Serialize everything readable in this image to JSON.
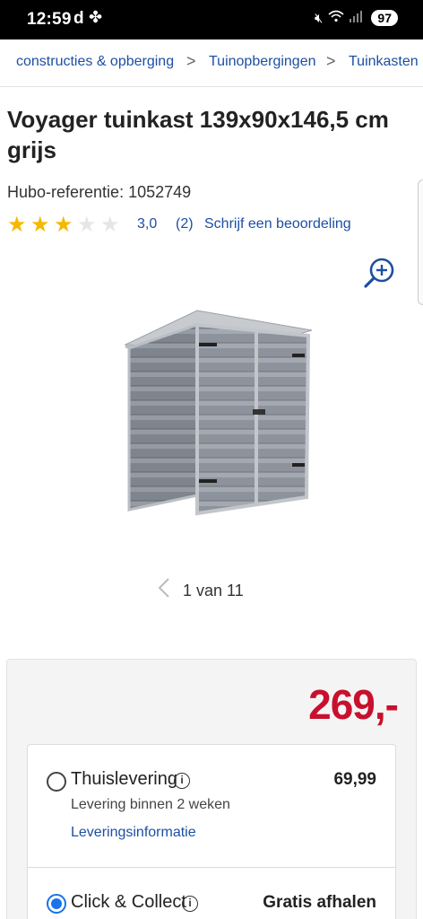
{
  "status_bar": {
    "time": "12:59",
    "carrier_glyph": "d",
    "battery": "97",
    "icons": [
      "pinwheel-icon",
      "mute-icon",
      "wifi-icon",
      "signal-icon",
      "battery-icon"
    ]
  },
  "breadcrumb": {
    "items": [
      "constructies & opberging",
      "Tuinopbergingen",
      "Tuinkasten"
    ],
    "separator": ">"
  },
  "product": {
    "title": "Voyager tuinkast 139x90x146,5 cm grijs",
    "reference": "Hubo-referentie: 1052749",
    "rating": {
      "value": "3,0",
      "count": "(2)",
      "stars": 3,
      "max": 5,
      "review_link": "Schrijf een beoordeling"
    }
  },
  "gallery": {
    "counter": "1 van 11",
    "icons": [
      "zoom-in-icon",
      "chevron-left-icon"
    ]
  },
  "pricing": {
    "price": "269,-",
    "options": [
      {
        "title": "Thuislevering",
        "price": "69,99",
        "subtitle": "Levering binnen 2 weken",
        "link": "Leveringsinformatie",
        "selected": false
      },
      {
        "title": "Click & Collect",
        "price": "Gratis afhalen",
        "selected": true
      }
    ]
  },
  "colors": {
    "link_blue": "#1d4fa3",
    "price_red": "#c8102e",
    "star_gold": "#f5b800",
    "radio_blue": "#1a73e8"
  }
}
